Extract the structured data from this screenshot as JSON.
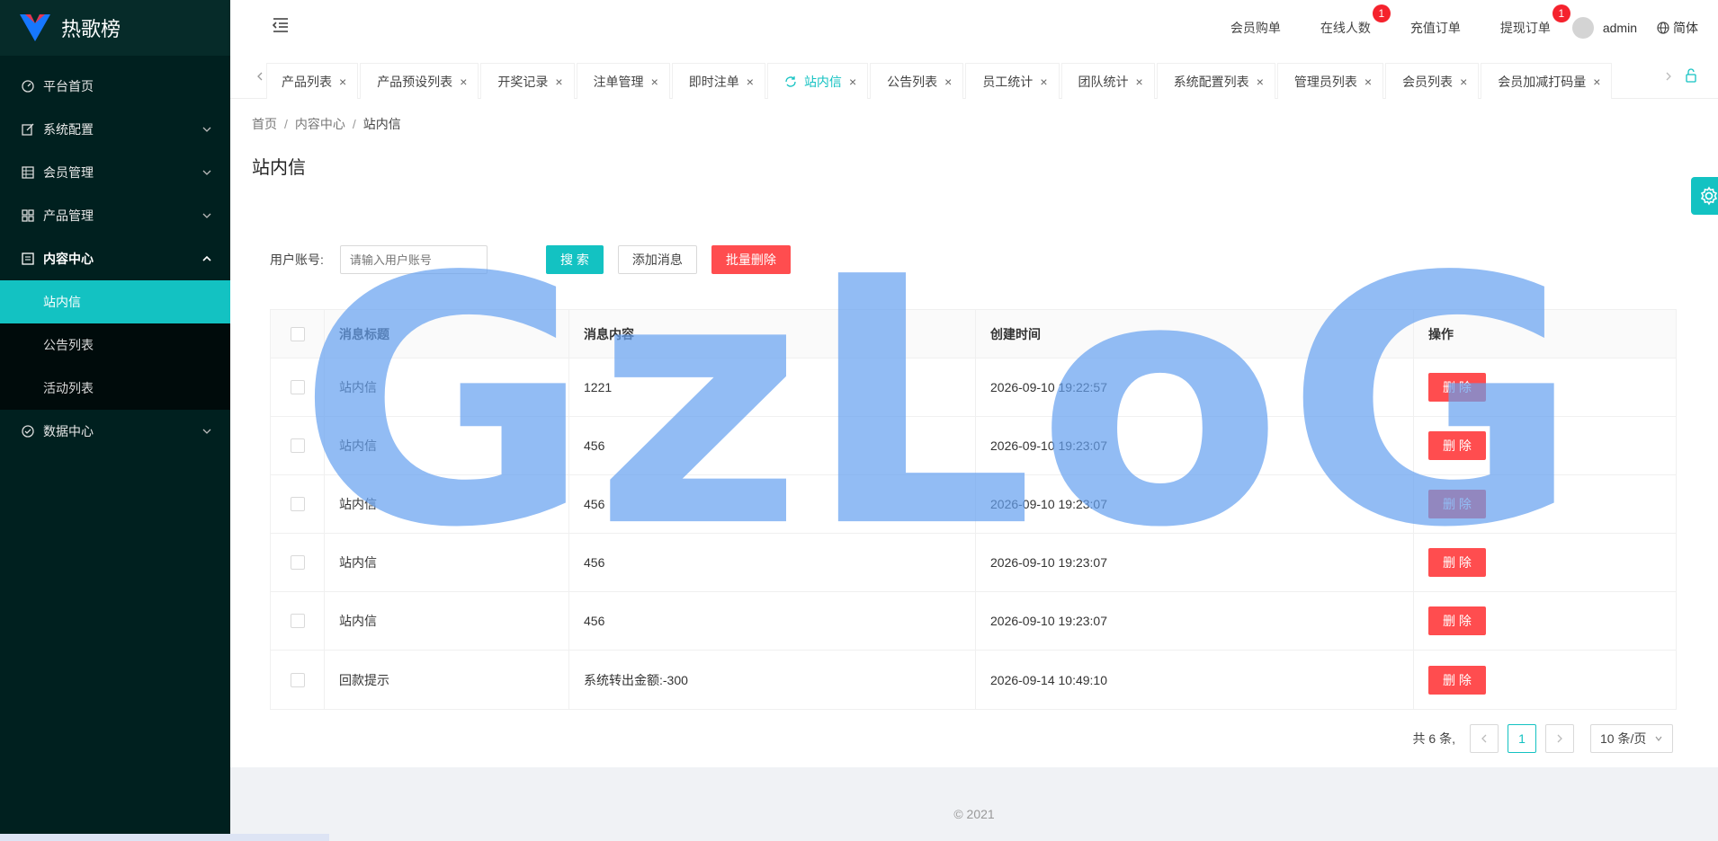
{
  "app": {
    "name": "热歌榜"
  },
  "sidebar": {
    "items": [
      {
        "label": "平台首页",
        "icon": "dashboard-icon"
      },
      {
        "label": "系统配置",
        "icon": "edit-icon"
      },
      {
        "label": "会员管理",
        "icon": "table-icon"
      },
      {
        "label": "产品管理",
        "icon": "appstore-icon"
      },
      {
        "label": "内容中心",
        "icon": "profile-icon"
      },
      {
        "label": "数据中心",
        "icon": "check-circle-icon"
      }
    ],
    "content_sub": [
      {
        "label": "站内信",
        "selected": true
      },
      {
        "label": "公告列表"
      },
      {
        "label": "活动列表"
      }
    ]
  },
  "header": {
    "links": [
      {
        "label": "会员购单"
      },
      {
        "label": "在线人数",
        "badge": "1"
      },
      {
        "label": "充值订单"
      },
      {
        "label": "提现订单",
        "badge": "1"
      }
    ],
    "user": "admin",
    "lang": "简体"
  },
  "tabs": [
    "产品列表",
    "产品预设列表",
    "开奖记录",
    "注单管理",
    "即时注单",
    "站内信",
    "公告列表",
    "员工统计",
    "团队统计",
    "系统配置列表",
    "管理员列表",
    "会员列表",
    "会员加减打码量"
  ],
  "active_tab": "站内信",
  "breadcrumb": [
    "首页",
    "内容中心",
    "站内信"
  ],
  "page": {
    "title": "站内信"
  },
  "search": {
    "label": "用户账号:",
    "placeholder": "请输入用户账号",
    "search_btn": "搜 索",
    "add_btn": "添加消息",
    "batch_delete_btn": "批量删除"
  },
  "table": {
    "headers": [
      "消息标题",
      "消息内容",
      "创建时间",
      "操作"
    ],
    "delete_label": "删 除",
    "rows": [
      {
        "title": "站内信",
        "content": "1221",
        "time": "2026-09-10 19:22:57"
      },
      {
        "title": "站内信",
        "content": "456",
        "time": "2026-09-10 19:23:07"
      },
      {
        "title": "站内信",
        "content": "456",
        "time": "2026-09-10 19:23:07"
      },
      {
        "title": "站内信",
        "content": "456",
        "time": "2026-09-10 19:23:07"
      },
      {
        "title": "站内信",
        "content": "456",
        "time": "2026-09-10 19:23:07"
      },
      {
        "title": "回款提示",
        "content": "系统转出金额:-300",
        "time": "2026-09-14 10:49:10"
      }
    ]
  },
  "pagination": {
    "total": "共 6 条,",
    "current": "1",
    "size": "10 条/页"
  },
  "footer": "2021",
  "watermark": "GzLoG",
  "colors": {
    "primary": "#13c2c2",
    "danger": "#ff4d4f",
    "sidebar": "#00201f"
  }
}
